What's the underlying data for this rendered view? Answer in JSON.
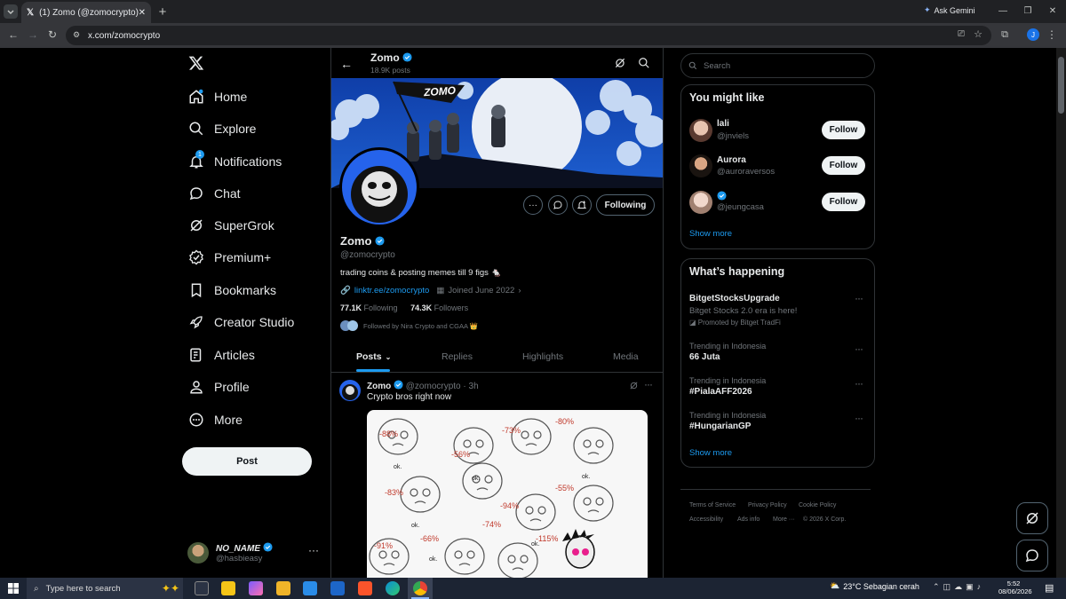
{
  "browser": {
    "tab_title": "(1) Zomo (@zomocrypto) / X",
    "url": "x.com/zomocrypto",
    "ask_gemini": "Ask Gemini",
    "profile_initial": "J"
  },
  "sidebar": {
    "items": [
      {
        "label": "Home",
        "icon": "home-icon"
      },
      {
        "label": "Explore",
        "icon": "search-icon"
      },
      {
        "label": "Notifications",
        "icon": "bell-icon",
        "badge": "1"
      },
      {
        "label": "Chat",
        "icon": "chat-icon"
      },
      {
        "label": "SuperGrok",
        "icon": "grok-icon"
      },
      {
        "label": "Premium+",
        "icon": "premium-icon"
      },
      {
        "label": "Bookmarks",
        "icon": "bookmark-icon"
      },
      {
        "label": "Creator Studio",
        "icon": "rocket-icon"
      },
      {
        "label": "Articles",
        "icon": "articles-icon"
      },
      {
        "label": "Profile",
        "icon": "person-icon"
      },
      {
        "label": "More",
        "icon": "more-circle-icon"
      }
    ],
    "post_button": "Post",
    "account": {
      "name": "NO_NAME",
      "handle": "@hasbieasy"
    }
  },
  "header": {
    "name": "Zomo",
    "posts": "18.9K posts"
  },
  "banner": {
    "flag_text": "ZOMO"
  },
  "profile": {
    "name": "Zomo",
    "handle": "@zomocrypto",
    "bio": "trading coins & posting memes till 9 figs 🐁",
    "link": "linktr.ee/zomocrypto",
    "joined": "Joined June 2022",
    "following_count": "77.1K",
    "following_label": "Following",
    "followers_count": "74.3K",
    "followers_label": "Followers",
    "followed_by": "Followed by Nira Crypto and CGAA 👑",
    "following_button": "Following"
  },
  "tabs": [
    "Posts",
    "Replies",
    "Highlights",
    "Media"
  ],
  "post": {
    "name": "Zomo",
    "handle": "@zomocrypto",
    "time": "· 3h",
    "text": "Crypto bros right now",
    "meme_percents": [
      "-88%",
      "-56%",
      "-73%",
      "-80%",
      "-83%",
      "-94%",
      "-55%",
      "-74%",
      "-66%",
      "-115%",
      "-91%"
    ],
    "meme_labels": [
      "ok."
    ]
  },
  "search": {
    "placeholder": "Search"
  },
  "you_might_like": {
    "title": "You might like",
    "users": [
      {
        "name": "lali",
        "handle": "@jnviels",
        "button": "Follow"
      },
      {
        "name": "Aurora",
        "handle": "@auroraversos",
        "button": "Follow"
      },
      {
        "name": "",
        "handle": "@jeungcasa",
        "button": "Follow"
      }
    ],
    "show_more": "Show more"
  },
  "whats_happening": {
    "title": "What’s happening",
    "promo": {
      "title": "BitgetStocksUpgrade",
      "subtitle": "Bitget Stocks 2.0 era is here!",
      "promoted": "Promoted by Bitget TradFi"
    },
    "trends": [
      {
        "context": "Trending in Indonesia",
        "title": "66 Juta"
      },
      {
        "context": "Trending in Indonesia",
        "title": "#PialaAFF2026"
      },
      {
        "context": "Trending in Indonesia",
        "title": "#HungarianGP"
      }
    ],
    "show_more": "Show more"
  },
  "footer": {
    "links": [
      "Terms of Service",
      "Privacy Policy",
      "Cookie Policy",
      "Accessibility",
      "Ads info",
      "More ···"
    ],
    "copyright": "© 2026 X Corp."
  },
  "taskbar": {
    "search_placeholder": "Type here to search",
    "weather": "23°C  Sebagian cerah",
    "time": "5:52",
    "date": "08/06/2026"
  },
  "colors": {
    "accent": "#1d9bf0",
    "background": "#000000",
    "border": "#2f3336",
    "muted": "#71767b"
  }
}
